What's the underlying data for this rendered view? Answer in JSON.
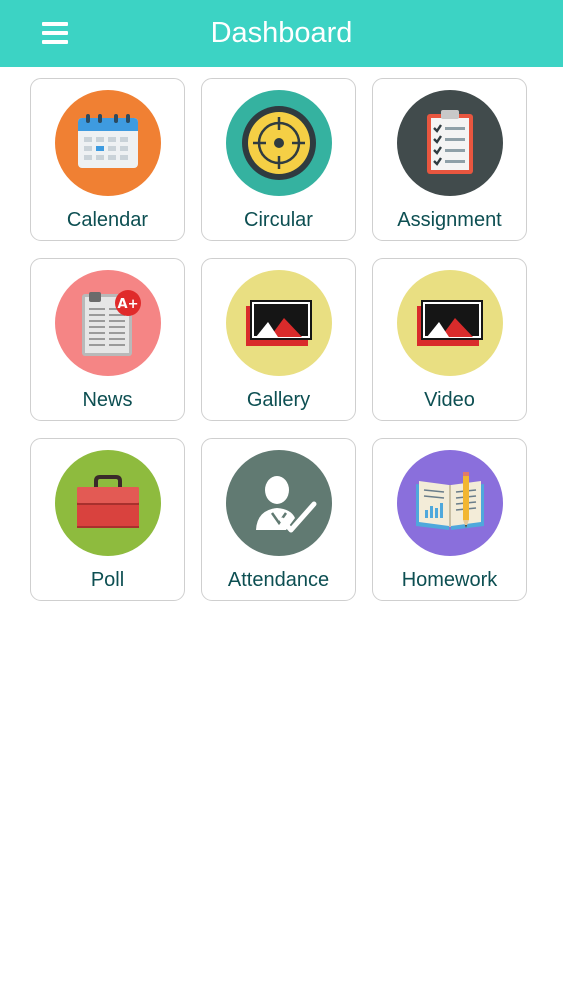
{
  "header": {
    "title": "Dashboard",
    "menu_icon": "hamburger-menu-icon",
    "color": "#3cd3c4"
  },
  "tiles": [
    {
      "label": "Calendar",
      "icon": "calendar-icon",
      "circle_color": "#f08033"
    },
    {
      "label": "Circular",
      "icon": "target-icon",
      "circle_color": "#35b2a0"
    },
    {
      "label": "Assignment",
      "icon": "clipboard-checklist-icon",
      "circle_color": "#414b4c"
    },
    {
      "label": "News",
      "icon": "newspaper-icon",
      "circle_color": "#f58585"
    },
    {
      "label": "Gallery",
      "icon": "image-icon",
      "circle_color": "#e9df82"
    },
    {
      "label": "Video",
      "icon": "video-icon",
      "circle_color": "#e9df82"
    },
    {
      "label": "Poll",
      "icon": "briefcase-icon",
      "circle_color": "#8ebb3e"
    },
    {
      "label": "Attendance",
      "icon": "person-check-icon",
      "circle_color": "#617a72"
    },
    {
      "label": "Homework",
      "icon": "open-book-icon",
      "circle_color": "#8a6fdc"
    }
  ]
}
